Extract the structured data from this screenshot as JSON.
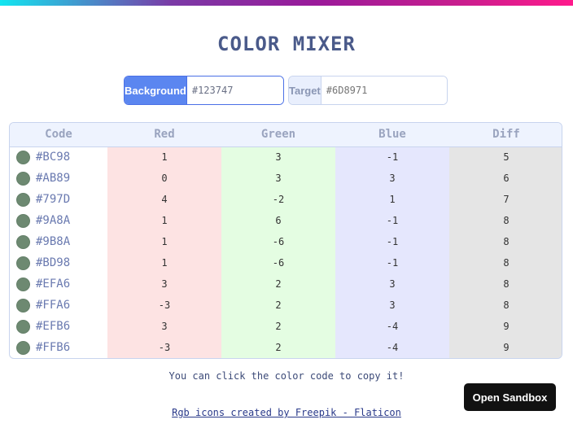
{
  "title": "COLOR MIXER",
  "background": {
    "label": "Background",
    "value": "#123747"
  },
  "target": {
    "label": "Target",
    "placeholder": "#6D8971"
  },
  "table": {
    "headers": {
      "code": "Code",
      "red": "Red",
      "green": "Green",
      "blue": "Blue",
      "diff": "Diff"
    },
    "swatch_color": "#6D8971",
    "rows": [
      {
        "code": "#BC98",
        "red": "1",
        "green": "3",
        "blue": "-1",
        "diff": "5"
      },
      {
        "code": "#AB89",
        "red": "0",
        "green": "3",
        "blue": "3",
        "diff": "6"
      },
      {
        "code": "#797D",
        "red": "4",
        "green": "-2",
        "blue": "1",
        "diff": "7"
      },
      {
        "code": "#9A8A",
        "red": "1",
        "green": "6",
        "blue": "-1",
        "diff": "8"
      },
      {
        "code": "#9B8A",
        "red": "1",
        "green": "-6",
        "blue": "-1",
        "diff": "8"
      },
      {
        "code": "#BD98",
        "red": "1",
        "green": "-6",
        "blue": "-1",
        "diff": "8"
      },
      {
        "code": "#EFA6",
        "red": "3",
        "green": "2",
        "blue": "3",
        "diff": "8"
      },
      {
        "code": "#FFA6",
        "red": "-3",
        "green": "2",
        "blue": "3",
        "diff": "8"
      },
      {
        "code": "#EFB6",
        "red": "3",
        "green": "2",
        "blue": "-4",
        "diff": "9"
      },
      {
        "code": "#FFB6",
        "red": "-3",
        "green": "2",
        "blue": "-4",
        "diff": "9"
      }
    ]
  },
  "hint": "You can click the color code to copy it!",
  "attribution": "Rgb icons created by Freepik - Flaticon",
  "sandbox_button": "Open Sandbox"
}
